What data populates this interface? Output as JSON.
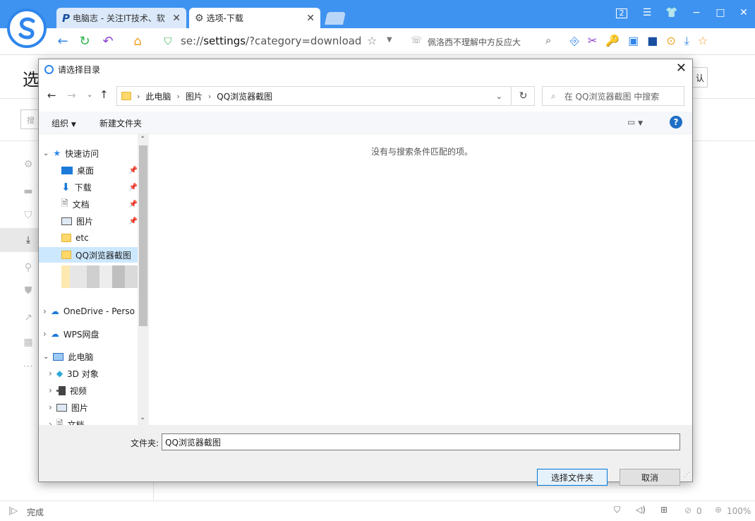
{
  "browser": {
    "tabs": [
      {
        "label": "电脑志 - 关注IT技术、软"
      },
      {
        "label": "选项-下载"
      }
    ],
    "url_prefix": "se://",
    "url_host": "settings",
    "url_path": "/?category=download",
    "search_hint": "佩洛西不理解中方反应大",
    "tab_count": "2"
  },
  "page": {
    "heading_partial": "选",
    "search_partial": "搜",
    "right_button_partial": "认",
    "status": "完成",
    "blocked_count": "0",
    "zoom": "100%"
  },
  "dialog": {
    "title": "请选择目录",
    "breadcrumb": [
      "此电脑",
      "图片",
      "QQ浏览器截图"
    ],
    "search_placeholder": "在 QQ浏览器截图 中搜索",
    "organize": "组织",
    "new_folder": "新建文件夹",
    "empty_message": "没有与搜索条件匹配的项。",
    "folder_label": "文件夹:",
    "folder_value": "QQ浏览器截图",
    "select_button": "选择文件夹",
    "cancel_button": "取消",
    "tree": {
      "quick_access": "快速访问",
      "desktop": "桌面",
      "downloads": "下载",
      "documents": "文档",
      "pictures": "图片",
      "etc": "etc",
      "qq_screens": "QQ浏览器截图",
      "onedrive": "OneDrive - Perso",
      "wps": "WPS网盘",
      "this_pc": "此电脑",
      "objects3d": "3D 对象",
      "videos": "视频",
      "pc_pictures": "图片",
      "pc_documents": "文档"
    }
  }
}
